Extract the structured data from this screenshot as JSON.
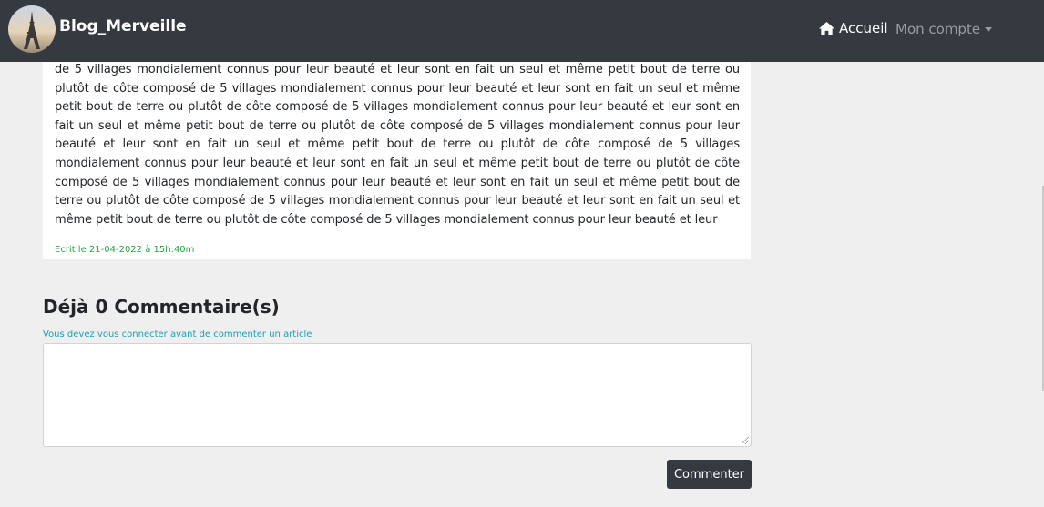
{
  "navbar": {
    "brand": "Blog_Merveille",
    "home_label": "Accueil",
    "account_label": "Mon compte",
    "home_icon": "home-icon",
    "logo_icon": "eiffel-tower-logo"
  },
  "article": {
    "body": "de 5 villages mondialement connus pour leur beauté et leur sont en fait un seul et même petit bout de terre ou plutôt de côte composé de 5 villages mondialement connus pour leur beauté et leur sont en fait un seul et même petit bout de terre ou plutôt de côte composé de 5 villages mondialement connus pour leur beauté et leur sont en fait un seul et même petit bout de terre ou plutôt de côte composé de 5 villages mondialement connus pour leur beauté et leur sont en fait un seul et même petit bout de terre ou plutôt de côte composé de 5 villages mondialement connus pour leur beauté et leur sont en fait un seul et même petit bout de terre ou plutôt de côte composé de 5 villages mondialement connus pour leur beauté et leur sont en fait un seul et même petit bout de terre ou plutôt de côte composé de 5 villages mondialement connus pour leur beauté et leur sont en fait un seul et même petit bout de terre ou plutôt de côte composé de 5 villages mondialement connus pour leur beauté et leur",
    "date": "Ecrit le 21-04-2022 à 15h:40m"
  },
  "comments": {
    "title": "Déjà 0 Commentaire(s)",
    "login_note": "Vous devez vous connecter avant de commenter un article",
    "textarea_value": "",
    "submit_label": "Commenter"
  },
  "colors": {
    "navbar_bg": "#343a40",
    "date_color": "#28a745",
    "note_color": "#17a2b8"
  }
}
